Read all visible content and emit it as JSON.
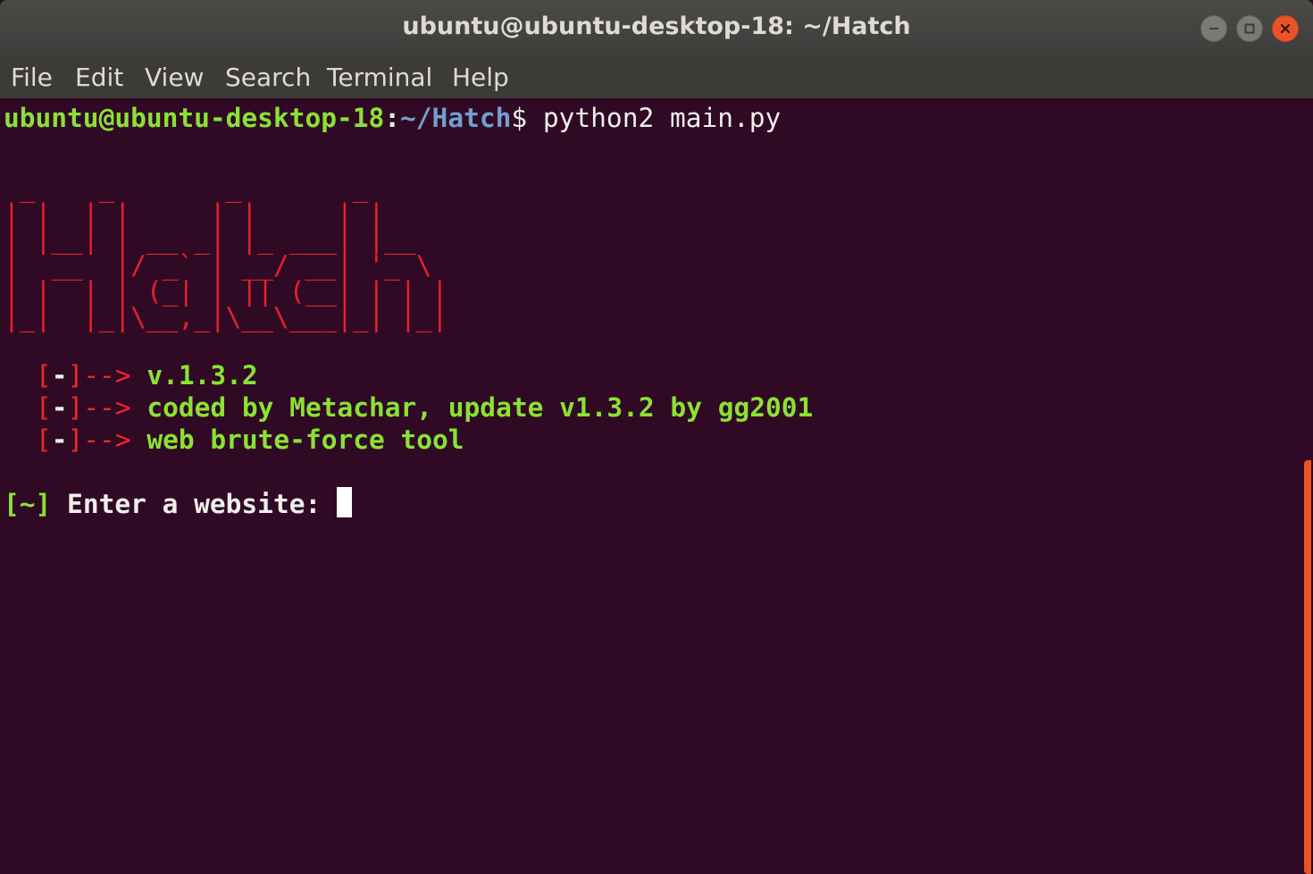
{
  "window": {
    "title": "ubuntu@ubuntu-desktop-18: ~/Hatch",
    "accent_color": "#e95420",
    "close_color": "#e8532a"
  },
  "menu": {
    "items": [
      "File",
      "Edit",
      "View",
      "Search",
      "Terminal",
      "Help"
    ]
  },
  "terminal": {
    "prompt_user_host": "ubuntu@ubuntu-desktop-18",
    "prompt_colon": ":",
    "prompt_path": "~/Hatch",
    "prompt_dollar": "$",
    "command": " python2 main.py",
    "banner_art": [
      " _    _       _       _     ",
      "| |  | |     | |     | |    ",
      "| |__| | __ _| |_ ___| |__  ",
      "|  __  |/ _` | __/ __| '_ \\ ",
      "| |  | | (_| | || (__| | | |",
      "|_|  |_|\\__,_|\\__\\___|_| |_|"
    ],
    "info_lines": [
      {
        "open": "[",
        "dash": "-",
        "arrow": "]-->",
        "text": " v.1.3.2"
      },
      {
        "open": "[",
        "dash": "-",
        "arrow": "]-->",
        "text": " coded by Metachar, update v1.3.2 by gg2001"
      },
      {
        "open": "[",
        "dash": "-",
        "arrow": "]-->",
        "text": " web brute-force tool"
      }
    ],
    "input_prompt_bracket": "[~]",
    "input_prompt_text": " Enter a website: ",
    "input_value": ""
  }
}
